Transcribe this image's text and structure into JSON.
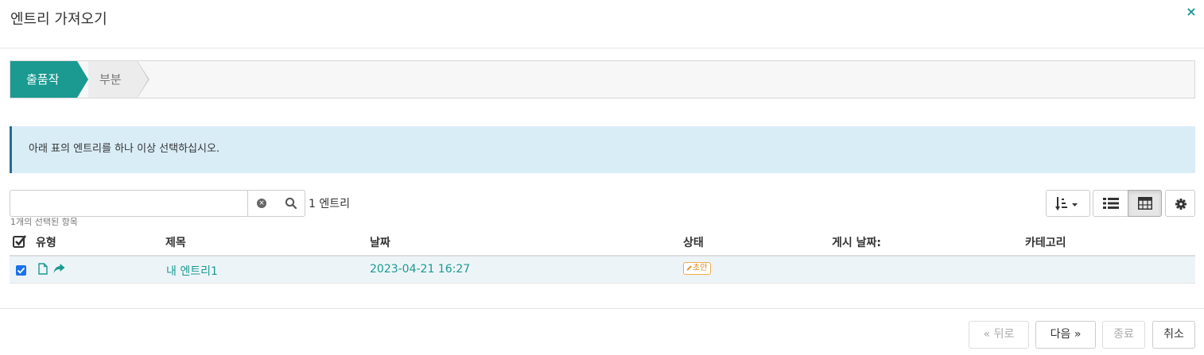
{
  "dialog": {
    "title": "엔트리 가져오기",
    "close_label": "×"
  },
  "steps": [
    {
      "label": "출품작",
      "active": true
    },
    {
      "label": "부분",
      "active": false
    }
  ],
  "alert": {
    "text": "아래 표의 엔트리를 하나 이상 선택하십시오."
  },
  "search": {
    "value": "",
    "placeholder": "",
    "entry_count": "1 엔트리",
    "selected_count": "1개의 선택된 항목"
  },
  "toolbar": {
    "sort_icon": "sort-icon",
    "list_view_icon": "list-view-icon",
    "grid_view_icon": "grid-view-icon",
    "settings_icon": "gear-icon",
    "active_view": "grid"
  },
  "table": {
    "headers": {
      "type": "유형",
      "title": "제목",
      "date": "날짜",
      "status": "상태",
      "post_date": "게시 날짜:",
      "category": "카테고리"
    },
    "rows": [
      {
        "selected": true,
        "type_icons": [
          "document-icon",
          "share-arrow-icon"
        ],
        "title": "내 엔트리1",
        "date": "2023-04-21 16:27",
        "status": "초안",
        "status_icon": "pencil-icon",
        "post_date": "",
        "category": ""
      }
    ]
  },
  "footer": {
    "back_label": "« 뒤로",
    "next_label": "다음 »",
    "finish_label": "종료",
    "cancel_label": "취소"
  },
  "colors": {
    "accent": "#1a9a91",
    "alert_bg": "#d9edf7",
    "row_selected_bg": "#edf4f8",
    "badge_warning": "#f0ad4e"
  }
}
